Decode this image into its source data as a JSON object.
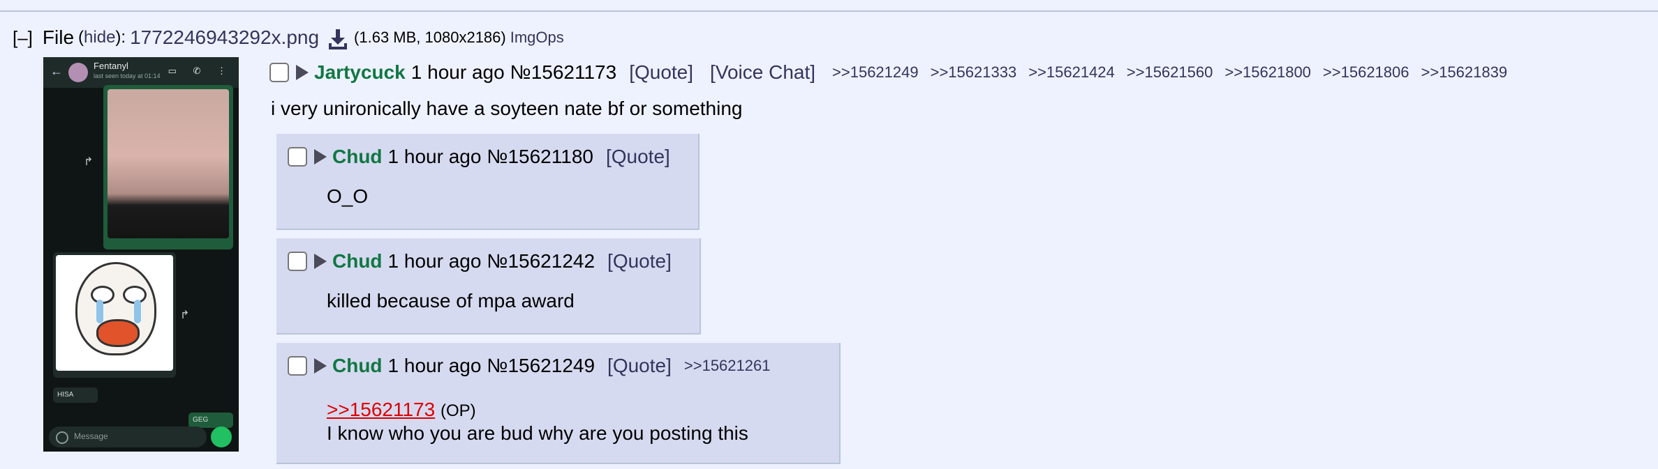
{
  "file": {
    "label": "File",
    "hide_open": "(",
    "hide_link": "hide",
    "hide_close": "):",
    "collapse_glyph": "[–]",
    "filename": "1772246943292x.png",
    "meta": "(1.63 MB, 1080x2186)",
    "imgops": "ImgOps"
  },
  "thumbnail": {
    "contact_name": "Fentanyl",
    "contact_status": "last seen today at 01:14",
    "hisa": "HISA",
    "geg": "GEG",
    "input_placeholder": "Message"
  },
  "op": {
    "name": "Jartycuck",
    "time": "1 hour ago",
    "post_no": "№15621173",
    "quote": "[Quote]",
    "voice_chat": "[Voice Chat]",
    "backlinks": [
      ">>15621249",
      ">>15621333",
      ">>15621424",
      ">>15621560",
      ">>15621800",
      ">>15621806",
      ">>15621839"
    ],
    "text": "i very unironically have a soyteen nate bf or something"
  },
  "replies": [
    {
      "name": "Chud",
      "time": "1 hour ago",
      "post_no": "№15621180",
      "quote": "[Quote]",
      "text": "O_O"
    },
    {
      "name": "Chud",
      "time": "1 hour ago",
      "post_no": "№15621242",
      "quote": "[Quote]",
      "text": "killed because of mpa award"
    },
    {
      "name": "Chud",
      "time": "1 hour ago",
      "post_no": "№15621249",
      "quote": "[Quote]",
      "backlink": ">>15621261",
      "quotelink": ">>15621173",
      "op_tag": "(OP)",
      "text": "I know who you are bud why are you posting this"
    }
  ],
  "colors": {
    "background": "#eef2ff",
    "reply_bg": "#d6daf0",
    "name_green": "#117743",
    "link": "#34345c",
    "quotelink_red": "#dd0000"
  }
}
